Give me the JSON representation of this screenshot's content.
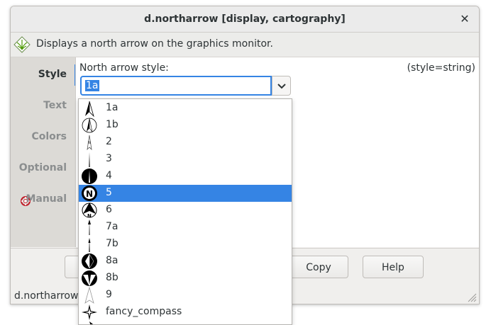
{
  "window": {
    "title": "d.northarrow [display, cartography]",
    "close_glyph": "✕"
  },
  "description": "Displays a north arrow on the graphics monitor.",
  "sidebar": {
    "tabs": [
      {
        "label": "Style",
        "active": true
      },
      {
        "label": "Text",
        "active": false
      },
      {
        "label": "Colors",
        "active": false
      },
      {
        "label": "Optional",
        "active": false
      },
      {
        "label": "Manual",
        "active": false,
        "icon": "lifebuoy-icon"
      }
    ]
  },
  "field": {
    "label": "North arrow style:",
    "hint": "(style=string)",
    "value": "1a"
  },
  "dropdown": {
    "selected": "5",
    "items": [
      {
        "label": "1a",
        "icon": "arrow-1a-icon"
      },
      {
        "label": "1b",
        "icon": "arrow-1b-icon"
      },
      {
        "label": "2",
        "icon": "arrow-2-icon"
      },
      {
        "label": "3",
        "icon": "arrow-3-icon"
      },
      {
        "label": "4",
        "icon": "arrow-4-icon"
      },
      {
        "label": "5",
        "icon": "arrow-5-icon"
      },
      {
        "label": "6",
        "icon": "arrow-6-icon"
      },
      {
        "label": "7a",
        "icon": "arrow-7a-icon"
      },
      {
        "label": "7b",
        "icon": "arrow-7b-icon"
      },
      {
        "label": "8a",
        "icon": "arrow-8a-icon"
      },
      {
        "label": "8b",
        "icon": "arrow-8b-icon"
      },
      {
        "label": "9",
        "icon": "arrow-9-icon"
      },
      {
        "label": "fancy_compass",
        "icon": "fancy-compass-icon"
      }
    ]
  },
  "buttons": {
    "copy": "Copy",
    "help": "Help"
  },
  "status": "d.northarrow",
  "colors": {
    "accent": "#3584e4"
  }
}
